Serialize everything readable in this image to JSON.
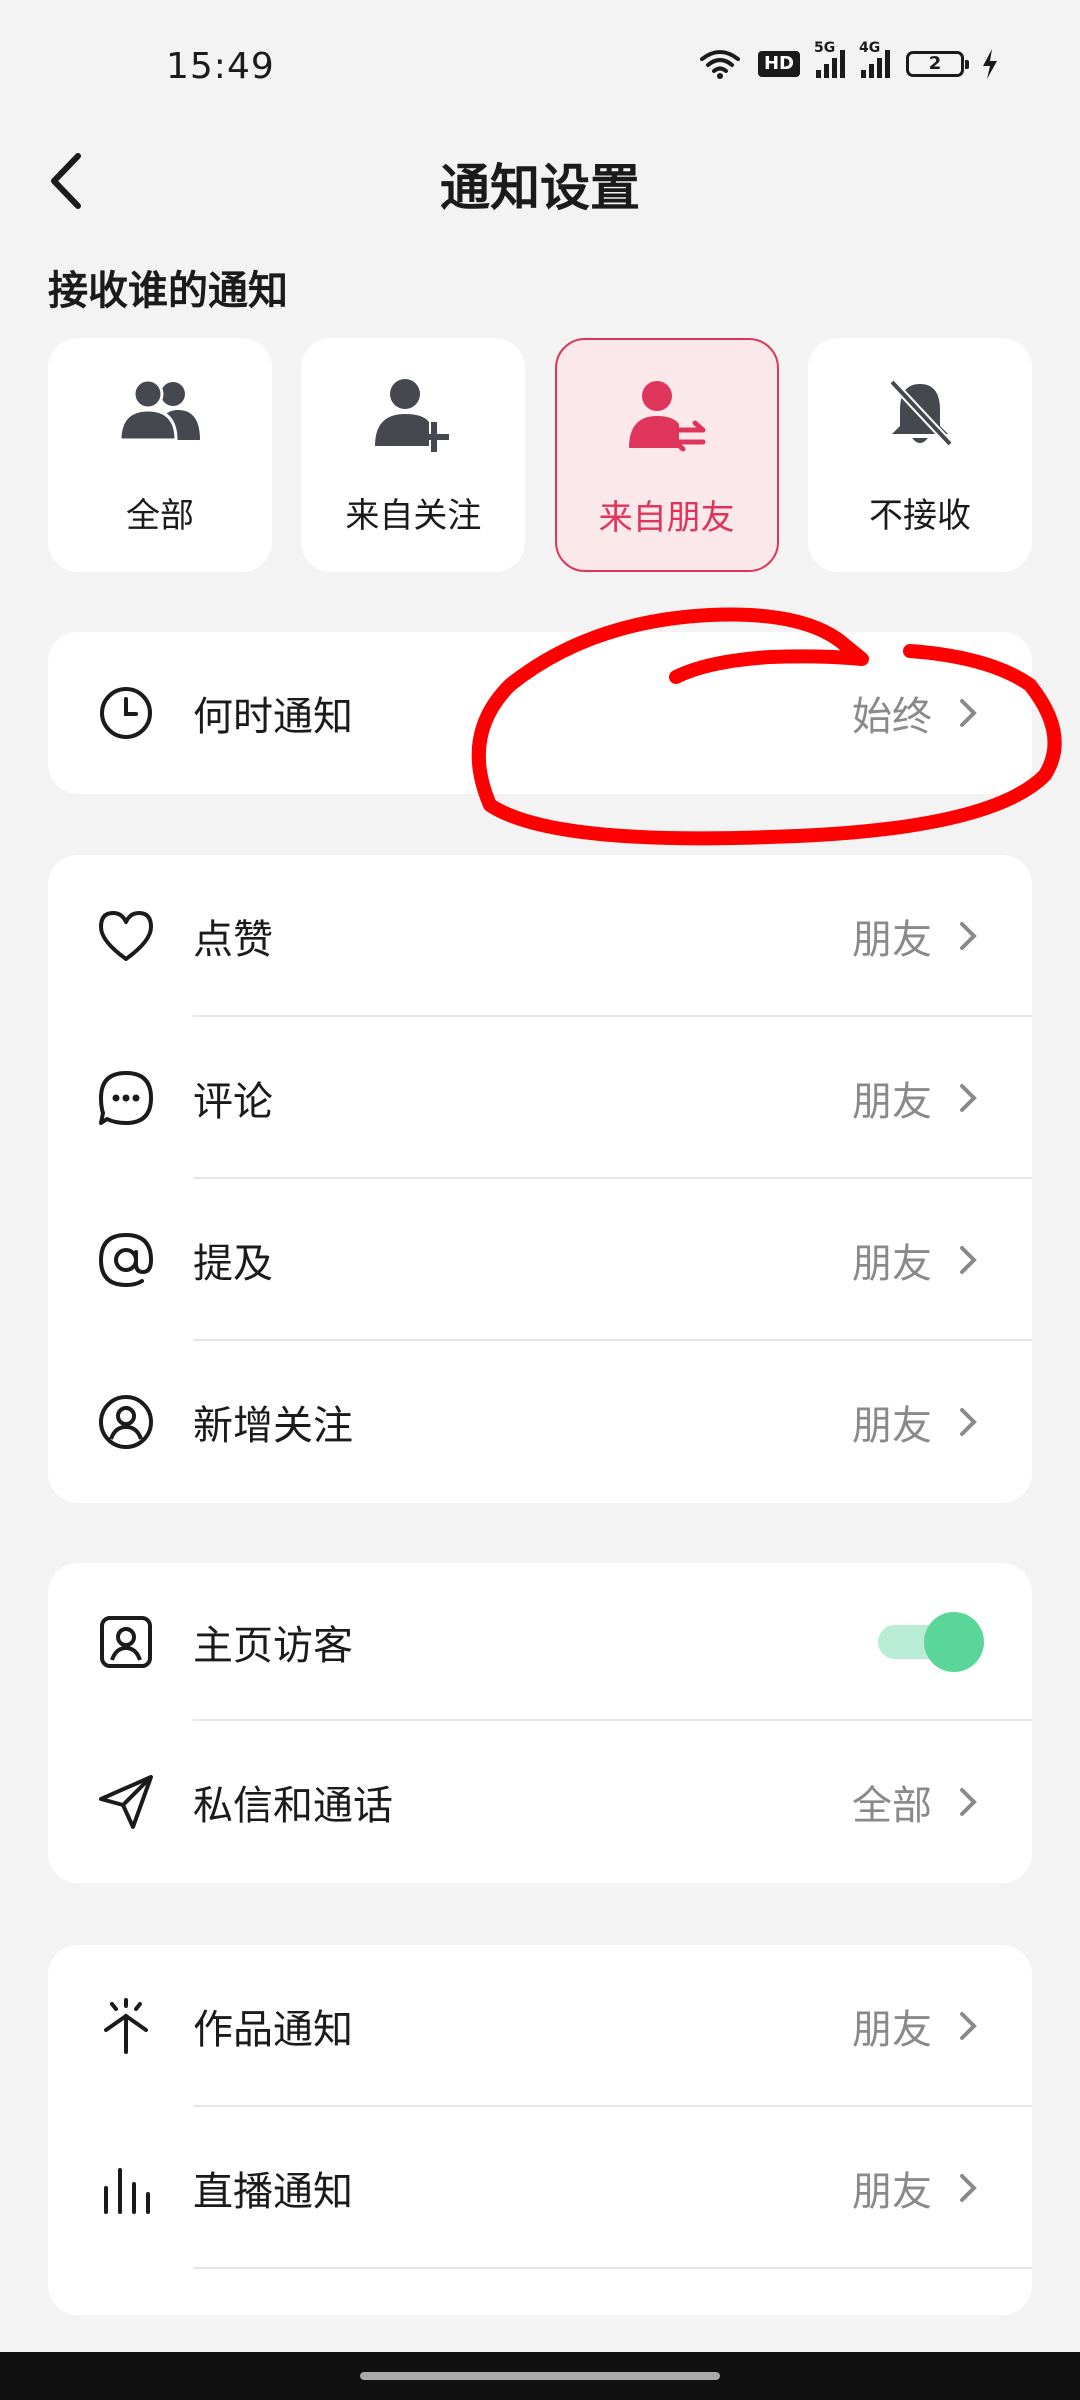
{
  "status_bar": {
    "time": "15:49",
    "hd_badge": "HD",
    "net1": "5G",
    "net2": "4G",
    "battery": "2",
    "icons": [
      "wifi-icon",
      "hd-icon",
      "signal-5g-icon",
      "signal-4g-icon",
      "battery-icon",
      "charging-icon"
    ]
  },
  "header": {
    "title": "通知设置",
    "back_icon": "chevron-left-icon"
  },
  "receive_section": {
    "label": "接收谁的通知",
    "options": [
      {
        "label": "全部",
        "icon": "group-icon",
        "selected": false
      },
      {
        "label": "来自关注",
        "icon": "user-add-icon",
        "selected": false
      },
      {
        "label": "来自朋友",
        "icon": "user-swap-icon",
        "selected": true
      },
      {
        "label": "不接收",
        "icon": "bell-off-icon",
        "selected": false
      }
    ]
  },
  "when_card": {
    "rows": [
      {
        "label": "何时通知",
        "value": "始终",
        "icon": "clock-icon"
      }
    ]
  },
  "interaction_card": {
    "rows": [
      {
        "label": "点赞",
        "value": "朋友",
        "icon": "heart-icon"
      },
      {
        "label": "评论",
        "value": "朋友",
        "icon": "comment-icon"
      },
      {
        "label": "提及",
        "value": "朋友",
        "icon": "at-icon"
      },
      {
        "label": "新增关注",
        "value": "朋友",
        "icon": "user-circle-icon"
      }
    ]
  },
  "visitor_card": {
    "rows": [
      {
        "label": "主页访客",
        "toggle_on": true,
        "icon": "profile-card-icon"
      },
      {
        "label": "私信和通话",
        "value": "全部",
        "icon": "send-icon"
      }
    ]
  },
  "content_card": {
    "rows": [
      {
        "label": "作品通知",
        "value": "朋友",
        "icon": "sparkle-icon"
      },
      {
        "label": "直播通知",
        "value": "朋友",
        "icon": "live-bars-icon"
      }
    ]
  },
  "colors": {
    "accent": "#e0355a",
    "selected_bg": "#fae8ea",
    "toggle_on": "#5bd699",
    "annotation": "#ff0000",
    "secondary_text": "#8a8a8a"
  }
}
